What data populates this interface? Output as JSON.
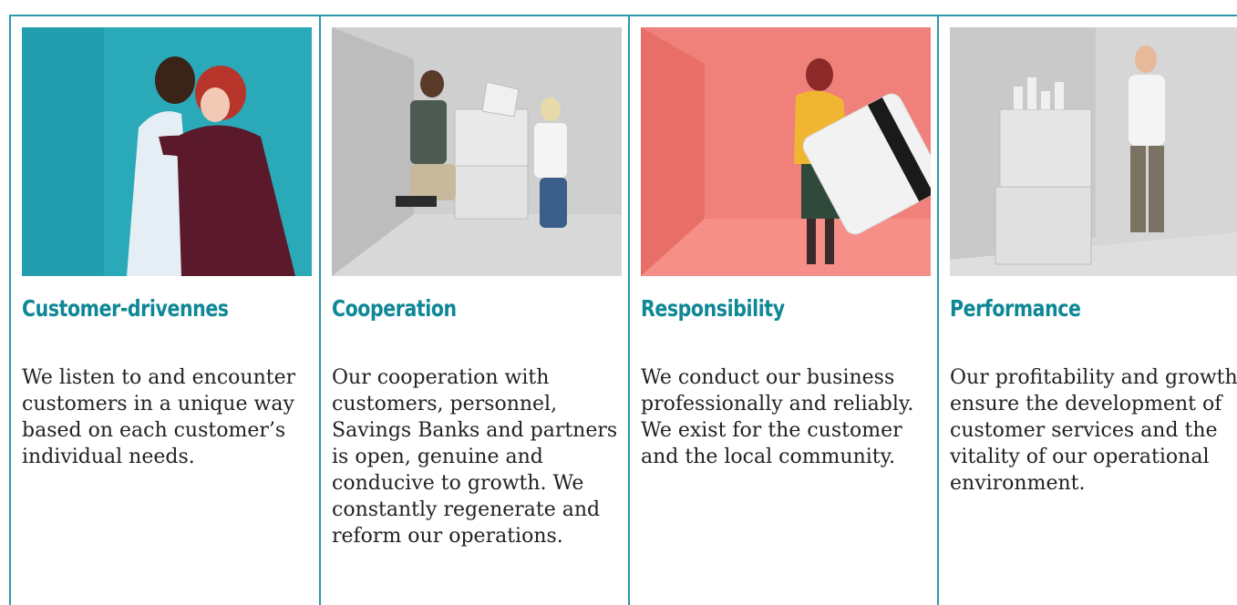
{
  "values": [
    {
      "title": "Customer-drivennes",
      "text": "We listen to and encounter customers in a unique way based on each customer’s individual needs.",
      "image": "photo-two-women-hugging-teal-background",
      "background": "#2aa9b9"
    },
    {
      "title": "Cooperation",
      "text": "Our cooperation with customers, personnel, Savings Banks and partners is open, genuine and conducive to growth. We constantly regenerate and reform our operations.",
      "image": "photo-two-people-carrying-boxes-grey-room",
      "background": "#cfcfcf"
    },
    {
      "title": "Responsibility",
      "text": "We conduct our business professionally and reliably. We exist for the customer and the local community.",
      "image": "photo-woman-holding-giant-card-coral-room",
      "background": "#f0807a"
    },
    {
      "title": "Performance",
      "text": "Our profitability and growth ensure the development of customer services and the vitality of our operational environment.",
      "image": "photo-man-leaning-on-boxes-grey-room",
      "background": "#d6d6d6"
    }
  ],
  "accent_color": "#0e8796",
  "divider_color": "#2a9aa8"
}
